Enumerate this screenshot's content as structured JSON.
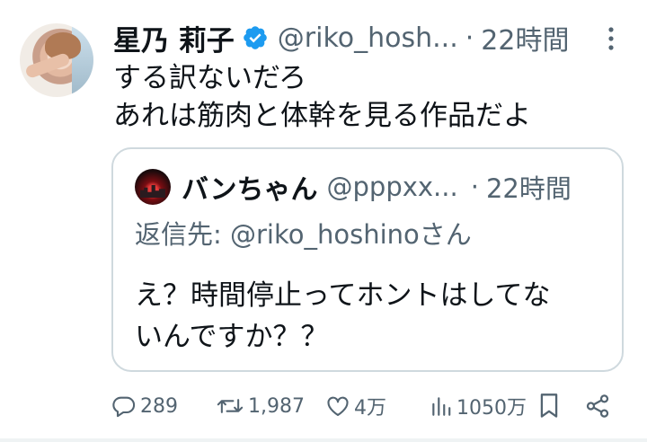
{
  "tweet": {
    "author_name": "星乃 莉子",
    "handle": "@riko_hosh...",
    "separator": "·",
    "time": "22時間",
    "text_lines": [
      "する訳ないだろ",
      "あれは筋肉と体幹を見る作品だよ"
    ]
  },
  "quote": {
    "author_name": "バンちゃん",
    "handle": "@pppxx...",
    "separator": "·",
    "time": "22時間",
    "reply_prefix": "返信先: ",
    "reply_mention": "@riko_hoshino",
    "reply_suffix": "さん",
    "text_lines": [
      "え？時間停止ってホントはしてな",
      "いんですか？？"
    ]
  },
  "actions": {
    "replies": "289",
    "retweets": "1,987",
    "likes": "4万",
    "views": "1050万"
  },
  "colors": {
    "verified_badge": "#1d9bf0",
    "secondary_text": "#536471",
    "primary_text": "#0f1419",
    "border": "#cfd9de"
  },
  "icons": {
    "verified": "verified-badge-icon",
    "more": "more-vertical-icon",
    "reply": "reply-icon",
    "retweet": "retweet-icon",
    "like": "heart-icon",
    "views": "views-bar-chart-icon",
    "bookmark": "bookmark-icon",
    "share": "share-icon"
  }
}
